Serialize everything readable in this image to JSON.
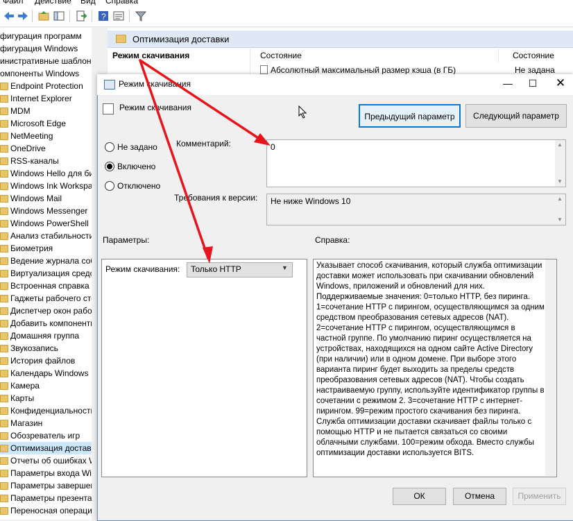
{
  "menubar": {
    "items": [
      "Файл",
      "Действие",
      "Вид",
      "Справка"
    ]
  },
  "toolbar": {
    "icons": [
      "back-arrow-icon",
      "forward-arrow-icon",
      "up-folder-icon",
      "show-hide-tree-icon",
      "export-list-icon",
      "help-icon",
      "properties-icon",
      "filter-icon"
    ]
  },
  "tree": {
    "items": [
      {
        "label": "фигурация программ"
      },
      {
        "label": "фигурация Windows"
      },
      {
        "label": "инистративные шаблоны"
      },
      {
        "label": "омпоненты Windows"
      },
      {
        "label": "Endpoint Protection"
      },
      {
        "label": "Internet Explorer"
      },
      {
        "label": "MDM"
      },
      {
        "label": "Microsoft Edge"
      },
      {
        "label": "NetMeeting"
      },
      {
        "label": "OneDrive"
      },
      {
        "label": "RSS-каналы"
      },
      {
        "label": "Windows Hello для биз"
      },
      {
        "label": "Windows Ink Workspac"
      },
      {
        "label": "Windows Mail"
      },
      {
        "label": "Windows Messenger"
      },
      {
        "label": "Windows PowerShell"
      },
      {
        "label": "Анализ стабильности"
      },
      {
        "label": "Биометрия"
      },
      {
        "label": "Ведение журнала собы"
      },
      {
        "label": "Виртуализация средст"
      },
      {
        "label": "Встроенная справка"
      },
      {
        "label": "Гаджеты рабочего сто"
      },
      {
        "label": "Диспетчер окон рабоч"
      },
      {
        "label": "Добавить компоненть"
      },
      {
        "label": "Домашняя группа"
      },
      {
        "label": "Звукозапись"
      },
      {
        "label": "История файлов"
      },
      {
        "label": "Календарь Windows"
      },
      {
        "label": "Камера"
      },
      {
        "label": "Карты"
      },
      {
        "label": "Конфиденциальность"
      },
      {
        "label": "Магазин"
      },
      {
        "label": "Обозреватель игр"
      },
      {
        "label": "Оптимизация доставки"
      },
      {
        "label": "Отчеты об ошибках W"
      },
      {
        "label": "Параметры входа Win"
      },
      {
        "label": "Параметры завершен"
      },
      {
        "label": "Параметры презентац"
      },
      {
        "label": "Переносная операцис"
      }
    ],
    "selected_label": "Оптимизация доставки"
  },
  "rightpane": {
    "header": "Оптимизация доставки",
    "left_title": "Режим скачивания",
    "col_setting": "Состояние",
    "col_state": "Состояние",
    "row1_setting": "Абсолютный максимальный размер кэша (в ГБ)",
    "row1_state": "Не задана"
  },
  "dialog": {
    "title": "Режим скачивания",
    "setting_name": "Режим скачивания",
    "btn_prev": "Предыдущий параметр",
    "btn_next": "Следующий параметр",
    "radio_not_configured": "Не задано",
    "radio_enabled": "Включено",
    "radio_disabled": "Отключено",
    "selected_radio": "Включено",
    "comment_label": "Комментарий:",
    "comment_value": "0",
    "version_label": "Требования к версии:",
    "version_value": "Не ниже Windows 10",
    "params_label": "Параметры:",
    "help_label": "Справка:",
    "param_mode_label": "Режим скачивания:",
    "param_mode_value": "Только HTTP",
    "help_text": "Указывает способ скачивания, который служба оптимизации доставки может использовать при скачивании обновлений Windows, приложений и обновлений для них. Поддерживаемые значения: 0=только HTTP, без пиринга. 1=сочетание HTTP с пирингом, осуществляющимся за одним средством преобразования сетевых адресов (NAT). 2=сочетание HTTP с пирингом, осуществляющимся в частной группе. По умолчанию пиринг осуществляется на устройствах, находящихся на одном сайте Active Directory (при наличии) или в одном домене. При выборе этого варианта пиринг будет выходить за пределы средств преобразования сетевых адресов (NAT). Чтобы создать настраиваемую группу, используйте идентификатор группы в сочетании с режимом 2. 3=сочетание HTTP с интернет-пирингом. 99=режим простого скачивания без пиринга. Служба оптимизации доставки скачивает файлы только с помощью HTTP и не пытается связаться со своими облачными службами. 100=режим обхода. Вместо службы оптимизации доставки используется BITS.",
    "btn_ok": "ОК",
    "btn_cancel": "Отмена",
    "btn_apply": "Применить",
    "min_glyph": "—",
    "max_glyph": "☐",
    "close_glyph": "✕"
  },
  "annotation": {
    "arrow_color": "#e8141b"
  }
}
